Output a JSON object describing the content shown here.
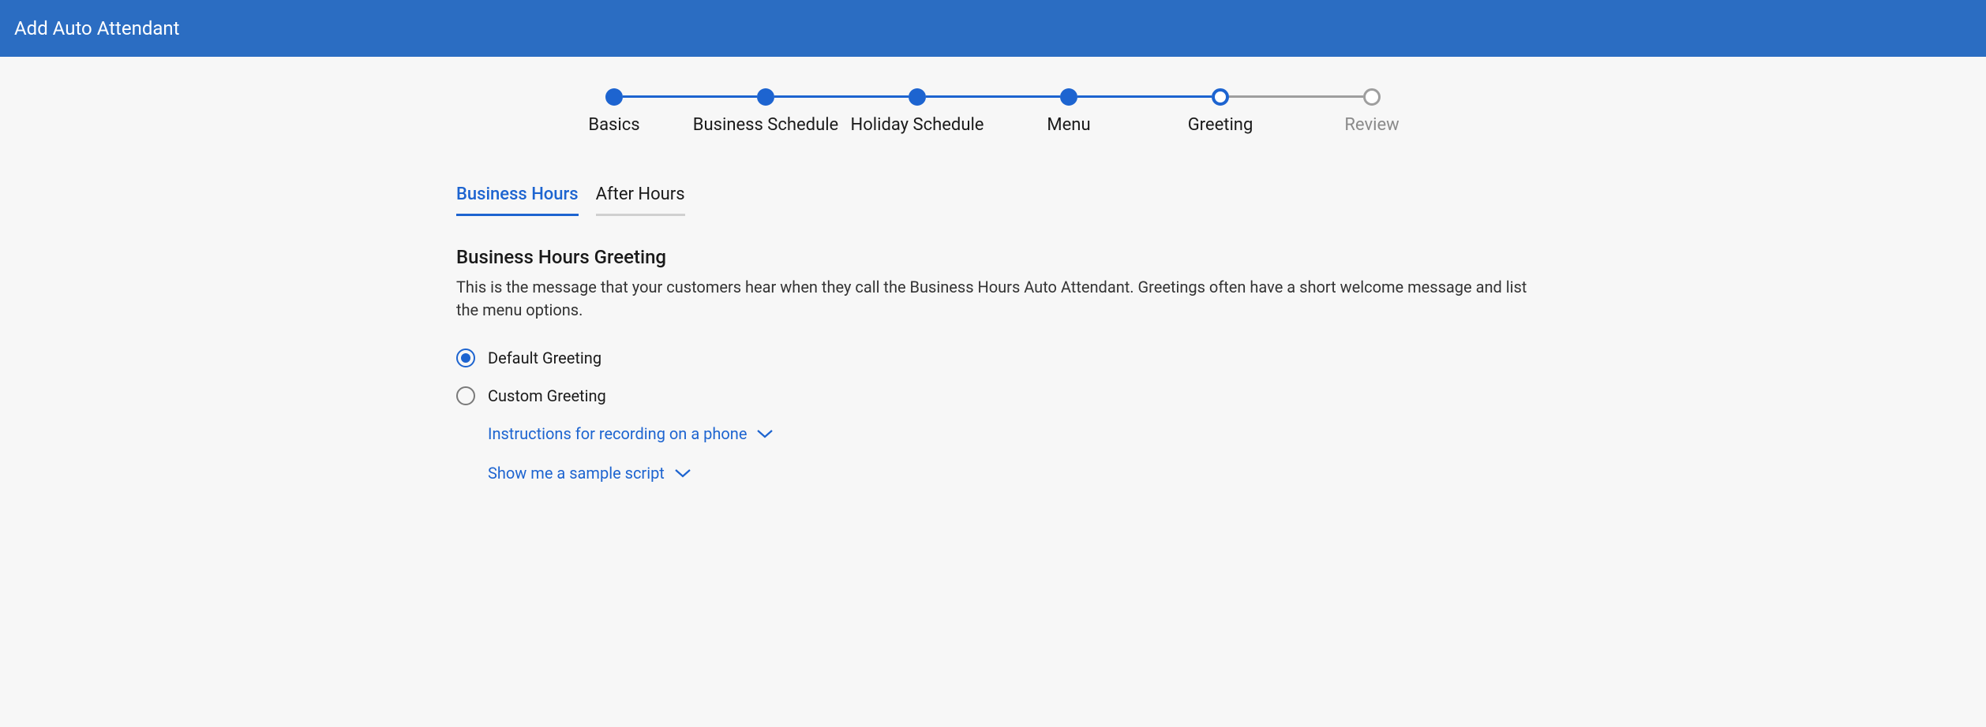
{
  "header": {
    "title": "Add Auto Attendant"
  },
  "stepper": {
    "steps": [
      {
        "label": "Basics",
        "state": "done"
      },
      {
        "label": "Business Schedule",
        "state": "done"
      },
      {
        "label": "Holiday Schedule",
        "state": "done"
      },
      {
        "label": "Menu",
        "state": "done"
      },
      {
        "label": "Greeting",
        "state": "current"
      },
      {
        "label": "Review",
        "state": "future"
      }
    ]
  },
  "tabs": [
    {
      "label": "Business Hours",
      "active": true
    },
    {
      "label": "After Hours",
      "active": false
    }
  ],
  "section": {
    "title": "Business Hours Greeting",
    "description": "This is the message that your customers hear when they call the Business Hours Auto Attendant. Greetings often have a short welcome message and list the menu options."
  },
  "greeting_options": [
    {
      "label": "Default Greeting",
      "selected": true
    },
    {
      "label": "Custom Greeting",
      "selected": false
    }
  ],
  "links": [
    {
      "label": "Instructions for recording on a phone"
    },
    {
      "label": "Show me a sample script"
    }
  ]
}
